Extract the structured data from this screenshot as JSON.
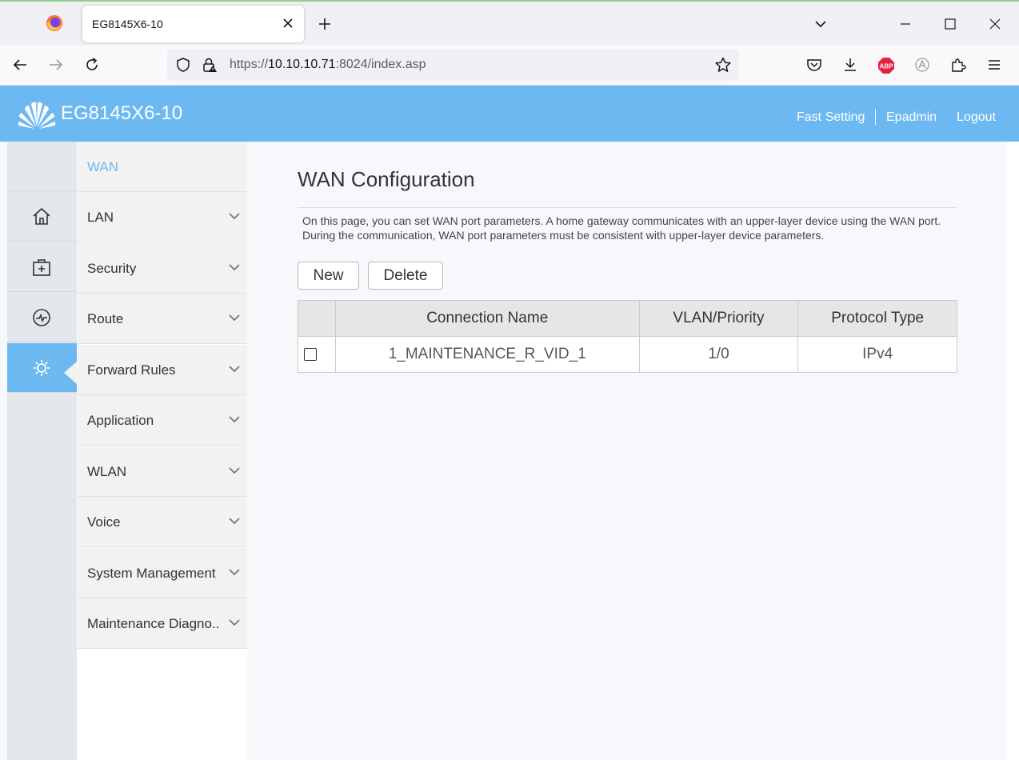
{
  "browser": {
    "tab_title": "EG8145X6-10",
    "url_scheme": "https://",
    "url_host": "10.10.10.71",
    "url_rest": ":8024/index.asp",
    "adblock_label": "ABP"
  },
  "header": {
    "brand": "EG8145X6-10",
    "links": {
      "fast_setting": "Fast Setting",
      "user": "Epadmin",
      "logout": "Logout"
    }
  },
  "iconbar": {
    "items": [
      "home-icon",
      "toolbox-icon",
      "pulse-icon",
      "settings-icon"
    ],
    "active": "settings-icon"
  },
  "submenu": {
    "items": [
      {
        "label": "WAN"
      },
      {
        "label": "LAN"
      },
      {
        "label": "Security"
      },
      {
        "label": "Route"
      },
      {
        "label": "Forward Rules"
      },
      {
        "label": "Application"
      },
      {
        "label": "WLAN"
      },
      {
        "label": "Voice"
      },
      {
        "label": "System Management"
      },
      {
        "label": "Maintenance Diagno.."
      }
    ],
    "active": "WAN"
  },
  "main": {
    "title": "WAN Configuration",
    "description": "On this page, you can set WAN port parameters. A home gateway communicates with an upper-layer device using the WAN port. During the communication, WAN port parameters must be consistent with upper-layer device parameters.",
    "buttons": {
      "new": "New",
      "delete": "Delete"
    },
    "table": {
      "headers": [
        "",
        "Connection Name",
        "VLAN/Priority",
        "Protocol Type"
      ],
      "rows": [
        {
          "checked": false,
          "name": "1_MAINTENANCE_R_VID_1",
          "vlan": "1/0",
          "protocol": "IPv4"
        }
      ]
    }
  },
  "colors": {
    "accent": "#6cb8f1",
    "adblock": "#e3223f"
  }
}
